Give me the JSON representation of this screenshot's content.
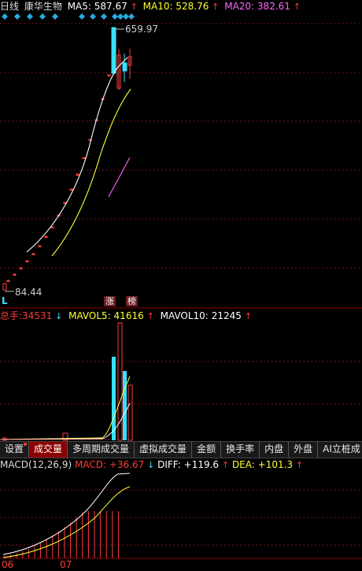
{
  "header": {
    "period": "日线",
    "stock_name": "康华生物",
    "ma5_label": "MA5:",
    "ma5_value": "587.67",
    "ma5_arrow": "↑",
    "ma10_label": "MA10:",
    "ma10_value": "528.76",
    "ma10_arrow": "↑",
    "ma20_label": "MA20:",
    "ma20_value": "382.61",
    "ma20_arrow": "↑"
  },
  "price_chart": {
    "high_label": "659.97",
    "low_label": "84.44",
    "corner_mark": "L",
    "tag_zhang": "涨",
    "tag_bang": "榜",
    "colors": {
      "up": "#ff3b3b",
      "down": "#36e2ff",
      "ma5": "#ffffff",
      "ma10": "#ffff33",
      "ma20": "#ff66ff",
      "marker": "#2aa8e0"
    }
  },
  "volume_header": {
    "total_label": "总手:",
    "total_value": "34531",
    "total_arrow": "↓",
    "mavol5_label": "MAVOL5:",
    "mavol5_value": "41616",
    "mavol5_arrow": "↑",
    "mavol10_label": "MAVOL10:",
    "mavol10_value": "21245",
    "mavol10_arrow": "↑"
  },
  "tabs": [
    {
      "label": "设置"
    },
    {
      "label": "成交量"
    },
    {
      "label": "多周期成交量"
    },
    {
      "label": "虚拟成交量"
    },
    {
      "label": "金额"
    },
    {
      "label": "换手率"
    },
    {
      "label": "内盘"
    },
    {
      "label": "外盘"
    },
    {
      "label": "AI立桩成"
    }
  ],
  "macd_header": {
    "name": "MACD(12,26,9)",
    "macd_label": "MACD:",
    "macd_value": "+36.67",
    "macd_arrow": "↓",
    "diff_label": "DIFF:",
    "diff_value": "+119.6",
    "diff_arrow": "↑",
    "dea_label": "DEA:",
    "dea_value": "+101.3",
    "dea_arrow": "↑"
  },
  "x_axis": {
    "label_06": "06",
    "label_07": "07"
  }
}
